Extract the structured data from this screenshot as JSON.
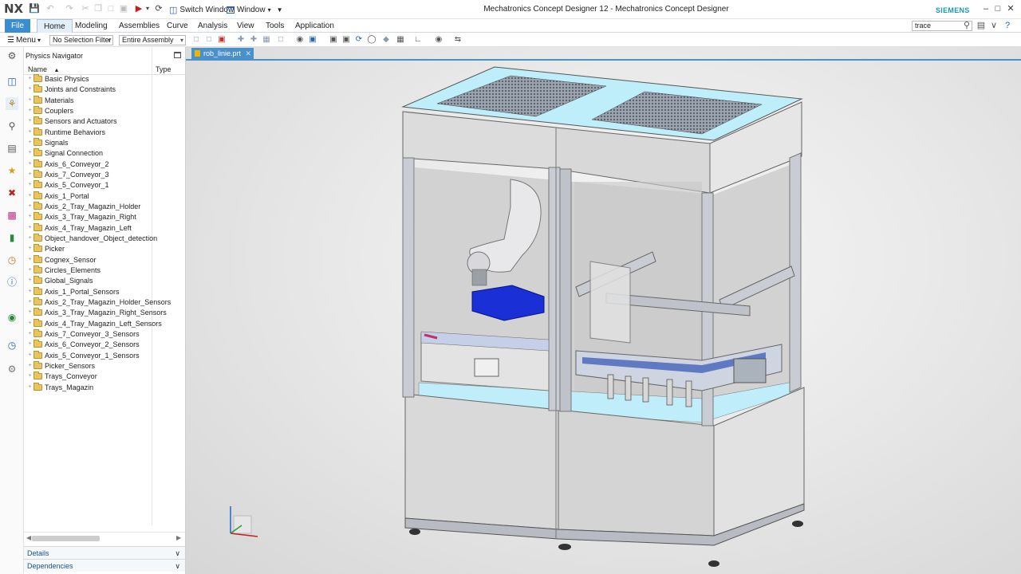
{
  "app": {
    "logo": "NX",
    "title": "Mechatronics Concept Designer 12 - Mechatronics Concept Designer",
    "brand": "SIEMENS",
    "switch_window": "Switch Window",
    "window_menu": "Window"
  },
  "ribbon": {
    "tabs": [
      "File",
      "Home",
      "Modeling",
      "Assemblies",
      "Curve",
      "Analysis",
      "View",
      "Tools",
      "Application"
    ],
    "active_tab": "Home",
    "search_value": "trace"
  },
  "toolbar": {
    "menu_label": "Menu",
    "selection_filter": "No Selection Filter",
    "scope": "Entire Assembly"
  },
  "navigator": {
    "title": "Physics Navigator",
    "columns": [
      "Name",
      "Type"
    ],
    "nodes": [
      "Basic Physics",
      "Joints and Constraints",
      "Materials",
      "Couplers",
      "Sensors and Actuators",
      "Runtime Behaviors",
      "Signals",
      "Signal Connection",
      "Axis_6_Conveyor_2",
      "Axis_7_Conveyor_3",
      "Axis_5_Conveyor_1",
      "Axis_1_Portal",
      "Axis_2_Tray_Magazin_Holder",
      "Axis_3_Tray_Magazin_Right",
      "Axis_4_Tray_Magazin_Left",
      "Object_handover_Object_detection",
      "Picker",
      "Cognex_Sensor",
      "Circles_Elements",
      "Global_Signals",
      "Axis_1_Portal_Sensors",
      "Axis_2_Tray_Magazin_Holder_Sensors",
      "Axis_3_Tray_Magazin_Right_Sensors",
      "Axis_4_Tray_Magazin_Left_Sensors",
      "Axis_7_Conveyor_3_Sensors",
      "Axis_6_Conveyor_2_Sensors",
      "Axis_5_Conveyor_1_Sensors",
      "Picker_Sensors",
      "Trays_Conveyor",
      "Trays_Magazin"
    ],
    "details_label": "Details",
    "dependencies_label": "Dependencies"
  },
  "viewport": {
    "part_tab": "rob_linie.prt",
    "colors": {
      "frame": "#c9cdd3",
      "panel": "#dcdcdc",
      "glass": "#bfeefa",
      "tray": "#1a2fd6",
      "robot": "#e8e8ea"
    }
  }
}
